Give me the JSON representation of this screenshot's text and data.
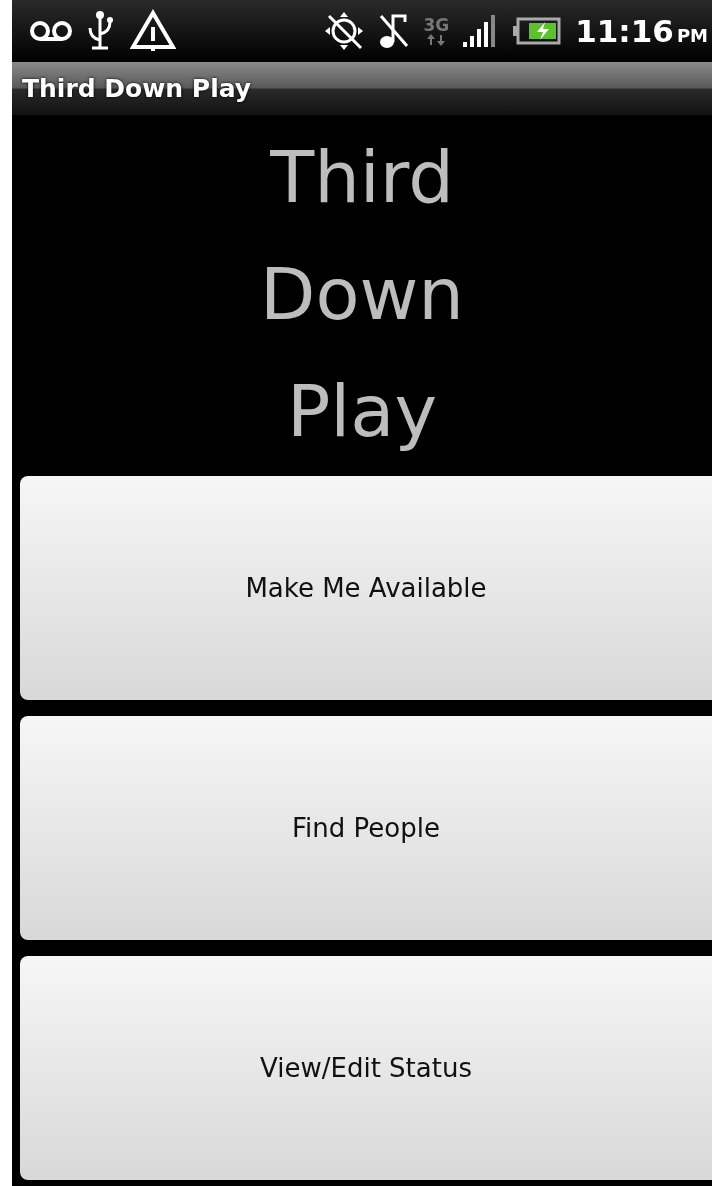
{
  "status_bar": {
    "network": "3G",
    "time": "11:16",
    "ampm": "PM"
  },
  "title_bar": {
    "title": "Third Down Play"
  },
  "heading": [
    "Third",
    "Down",
    "Play"
  ],
  "buttons": [
    {
      "label": "Make Me Available"
    },
    {
      "label": "Find People"
    },
    {
      "label": "View/Edit Status"
    }
  ]
}
